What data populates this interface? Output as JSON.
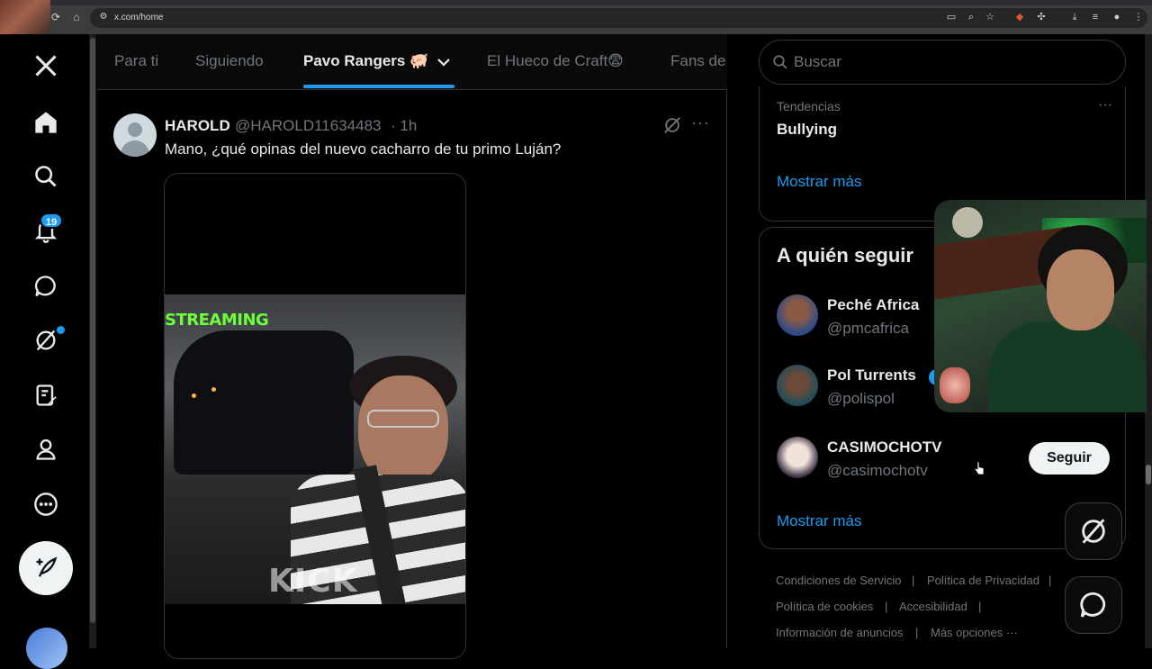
{
  "browser": {
    "url": "x.com/home",
    "overlay_tag": "x1916"
  },
  "tabs": [
    "Para ti",
    "Siguiendo",
    "Pavo Rangers 🐖",
    "El Hueco de Craft😨",
    "Fans de"
  ],
  "notifications_badge": "19",
  "tweet": {
    "name": "HAROLD",
    "handle": "@HAROLD11634483",
    "time": "· 1h",
    "text": "Mano, ¿qué opinas del nuevo cacharro de tu primo Luján?",
    "video_overlay_top": "STREAMING",
    "video_overlay_bottom": "KICK"
  },
  "search": {
    "placeholder": "Buscar"
  },
  "trends": {
    "category": "Tendencias",
    "name": "Bullying",
    "show_more": "Mostrar más"
  },
  "who_to_follow": {
    "title": "A quién seguir",
    "accounts": [
      {
        "name": "Peché Africa",
        "handle": "@pmcafrica"
      },
      {
        "name": "Pol Turrents",
        "handle": "@polispol"
      },
      {
        "name": "CASIMOCHOTV",
        "handle": "@casimochotv"
      }
    ],
    "follow_label": "Seguir",
    "show_more": "Mostrar más"
  },
  "footer": {
    "terms": "Condiciones de Servicio",
    "privacy": "Política de Privacidad",
    "cookies": "Política de cookies",
    "accessibility": "Accesibilidad",
    "ads": "Información de anuncios",
    "more": "Más opciones ···",
    "sep": "|"
  },
  "colors": {
    "accent": "#1d9bf0",
    "background": "#000000",
    "text": "#e7e9ea",
    "muted": "#71767b"
  }
}
